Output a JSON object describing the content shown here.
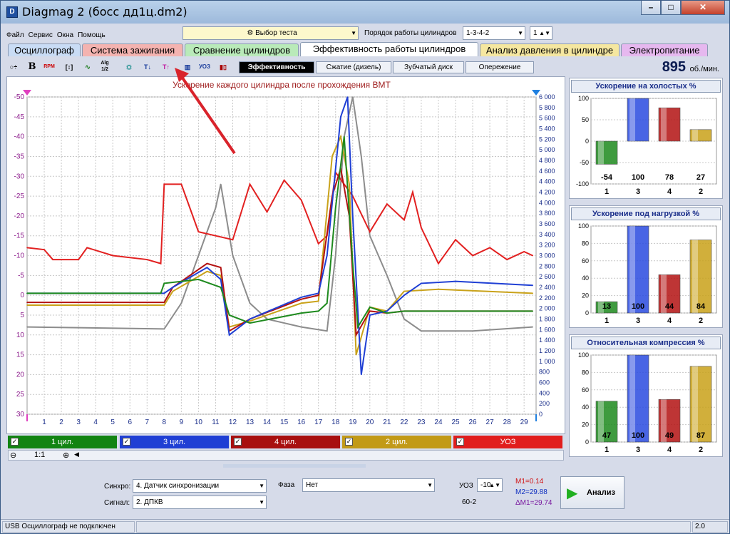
{
  "window": {
    "title": "Diagmag 2 (босс дд1ц.dm2)",
    "app_icon": "D"
  },
  "menu": [
    "Файл",
    "Сервис",
    "Окна",
    "Помощь"
  ],
  "test_select": {
    "value": "Выбор теста"
  },
  "cylinder_order": {
    "label": "Порядок работы цилиндров",
    "value": "1-3-4-2",
    "spin_value": "1"
  },
  "tabs": [
    {
      "label": "Осциллограф",
      "color": "#c9dcf5"
    },
    {
      "label": "Система зажигания",
      "color": "#f4b3b0"
    },
    {
      "label": "Сравнение цилиндров",
      "color": "#b9eab9"
    },
    {
      "label": "Эффективность работы цилиндров",
      "color": "#ffffff"
    },
    {
      "label": "Анализ давления в цилиндре",
      "color": "#f5e7a0"
    },
    {
      "label": "Электропитание",
      "color": "#e6b8ef"
    }
  ],
  "toolbar_icons": [
    "cursor-icon",
    "bold-icon",
    "rpm-icon",
    "measure-icon",
    "curve-icon",
    "algorithm-icon",
    "sensor-icon",
    "tdc-icon",
    "marker-icon",
    "cylinders-icon",
    "uoz-icon",
    "bar-icon"
  ],
  "toolbar_icon_text": {
    "rpm": "RPM",
    "alg": "Alg 1/2",
    "uoz": "УОЗ"
  },
  "subtabs": [
    "Эффективность",
    "Сжатие (дизель)",
    "Зубчатый диск",
    "Опережение"
  ],
  "rpm": {
    "value": "895",
    "unit": "об./мин."
  },
  "chart_data": {
    "type": "line",
    "title": "Ускорение каждого цилиндра после прохождения ВМТ",
    "x_ticks": [
      1,
      2,
      3,
      4,
      5,
      6,
      7,
      8,
      9,
      10,
      11,
      12,
      13,
      14,
      15,
      16,
      17,
      18,
      19,
      20,
      21,
      22,
      23,
      24,
      25,
      26,
      27,
      28,
      29
    ],
    "y_left_ticks": [
      -50,
      -45,
      -40,
      -35,
      -30,
      -25,
      -20,
      -15,
      -10,
      -5,
      0,
      5,
      10,
      15,
      20,
      25,
      30
    ],
    "y_left_range": [
      -50,
      30
    ],
    "y_right_ticks": [
      "6 000",
      "5 800",
      "5 600",
      "5 400",
      "5 200",
      "5 000",
      "4 800",
      "4 600",
      "4 400",
      "4 200",
      "4 000",
      "3 800",
      "3 600",
      "3 400",
      "3 200",
      "3 000",
      "2 800",
      "2 600",
      "2 400",
      "2 200",
      "2 000",
      "1 800",
      "1 600",
      "1 400",
      "1 200",
      "1 000",
      "800",
      "600",
      "400",
      "200",
      "0"
    ],
    "y_right_range": [
      0,
      6000
    ],
    "grid": true,
    "series": [
      {
        "name": "1 цил.",
        "color": "#1e8a1e",
        "points": [
          [
            0,
            -0.5
          ],
          [
            7.8,
            -0.5
          ],
          [
            8,
            -3
          ],
          [
            10,
            -4
          ],
          [
            11.3,
            -2
          ],
          [
            11.8,
            5
          ],
          [
            13,
            7
          ],
          [
            16,
            4.5
          ],
          [
            17,
            4
          ],
          [
            17.5,
            2
          ],
          [
            18,
            -22
          ],
          [
            18.5,
            -40
          ],
          [
            19,
            -8
          ],
          [
            19.3,
            8
          ],
          [
            20,
            3
          ],
          [
            21,
            4.5
          ],
          [
            22,
            4
          ],
          [
            29.5,
            4
          ]
        ]
      },
      {
        "name": "3 цил.",
        "color": "#1f3fd4",
        "points": [
          [
            0,
            -0.5
          ],
          [
            8,
            -0.5
          ],
          [
            8.5,
            -2
          ],
          [
            10.5,
            -7
          ],
          [
            11.3,
            -4
          ],
          [
            11.8,
            10
          ],
          [
            13,
            6
          ],
          [
            16,
            0.5
          ],
          [
            17,
            -0.5
          ],
          [
            17.5,
            -10
          ],
          [
            18.3,
            -45
          ],
          [
            18.7,
            -50
          ],
          [
            19,
            -20
          ],
          [
            19.5,
            20
          ],
          [
            20,
            5
          ],
          [
            21,
            4
          ],
          [
            22,
            0
          ],
          [
            23,
            -3
          ],
          [
            25,
            -3.5
          ],
          [
            29.5,
            -2.5
          ]
        ]
      },
      {
        "name": "4 цил.",
        "color": "#b31212",
        "points": [
          [
            0,
            1.8
          ],
          [
            8,
            1.8
          ],
          [
            8.5,
            -2
          ],
          [
            10.5,
            -8
          ],
          [
            11.3,
            -7
          ],
          [
            11.8,
            9
          ],
          [
            13,
            6
          ],
          [
            16,
            1
          ],
          [
            17,
            0
          ],
          [
            17.8,
            -25
          ],
          [
            18.3,
            -32
          ],
          [
            18.8,
            -20
          ],
          [
            19.2,
            10
          ],
          [
            20,
            4
          ],
          [
            21,
            4.5
          ],
          [
            22,
            4
          ],
          [
            29.5,
            4
          ]
        ]
      },
      {
        "name": "2 цил.",
        "color": "#c9a21a",
        "points": [
          [
            0,
            2.5
          ],
          [
            8,
            2.5
          ],
          [
            8.5,
            -1
          ],
          [
            10.5,
            -6
          ],
          [
            11.3,
            -5
          ],
          [
            11.8,
            8
          ],
          [
            13,
            6.5
          ],
          [
            16,
            2
          ],
          [
            17,
            1.5
          ],
          [
            17.8,
            -35
          ],
          [
            18.3,
            -40
          ],
          [
            18.8,
            -28
          ],
          [
            19.2,
            15
          ],
          [
            20,
            3
          ],
          [
            21,
            4
          ],
          [
            22,
            -1
          ],
          [
            24,
            -1.5
          ],
          [
            29.5,
            -0.5
          ]
        ]
      },
      {
        "name": "УОЗ",
        "color": "#e22020",
        "points": [
          [
            0,
            -12
          ],
          [
            1,
            -11.5
          ],
          [
            1.5,
            -9
          ],
          [
            3,
            -9
          ],
          [
            3.5,
            -12
          ],
          [
            5,
            -10
          ],
          [
            7,
            -9
          ],
          [
            7.8,
            -8
          ],
          [
            8,
            -28
          ],
          [
            9,
            -28
          ],
          [
            9.5,
            -22
          ],
          [
            10,
            -16
          ],
          [
            11,
            -15
          ],
          [
            12,
            -14
          ],
          [
            13,
            -28
          ],
          [
            14,
            -21
          ],
          [
            14.5,
            -25
          ],
          [
            15,
            -29
          ],
          [
            16,
            -24
          ],
          [
            17,
            -13
          ],
          [
            17.5,
            -15
          ],
          [
            18,
            -31
          ],
          [
            19,
            -25
          ],
          [
            20,
            -16
          ],
          [
            21,
            -23
          ],
          [
            22,
            -19
          ],
          [
            22.5,
            -26
          ],
          [
            23,
            -17
          ],
          [
            24,
            -8
          ],
          [
            25,
            -14
          ],
          [
            26,
            -10
          ],
          [
            27,
            -12
          ],
          [
            28,
            -9
          ],
          [
            29,
            -11
          ],
          [
            29.5,
            -10
          ]
        ]
      },
      {
        "name": "",
        "color": "#8c8c8c",
        "points": [
          [
            0,
            8
          ],
          [
            8,
            8.5
          ],
          [
            9,
            2
          ],
          [
            10,
            -10
          ],
          [
            11,
            -22
          ],
          [
            11.3,
            -28
          ],
          [
            12,
            -10
          ],
          [
            13,
            2
          ],
          [
            14,
            6
          ],
          [
            16,
            8
          ],
          [
            17.5,
            9
          ],
          [
            18,
            -10
          ],
          [
            18.5,
            -40
          ],
          [
            19,
            -50
          ],
          [
            19.5,
            -35
          ],
          [
            20,
            -15
          ],
          [
            21,
            -5
          ],
          [
            22,
            6
          ],
          [
            23,
            9
          ],
          [
            26,
            9
          ],
          [
            29.5,
            8
          ]
        ]
      }
    ]
  },
  "legend": [
    {
      "label": "1 цил.",
      "color": "#128412",
      "checked": "✓"
    },
    {
      "label": "3 цил.",
      "color": "#1f3fd4",
      "checked": "✓"
    },
    {
      "label": "4 цил.",
      "color": "#a80f0f",
      "checked": "✓"
    },
    {
      "label": "2 цил.",
      "color": "#c29a17",
      "checked": "✓"
    },
    {
      "label": "УОЗ",
      "color": "#e11d1d",
      "checked": "✓"
    }
  ],
  "zoom": {
    "minus": "⊖",
    "value": "1:1",
    "plus": "⊕"
  },
  "bar_panels": [
    {
      "title": "Ускорение на холостых %",
      "yticks": [
        "100",
        "50",
        "0",
        "-50",
        "-100"
      ],
      "yrange": [
        -100,
        100
      ],
      "bars": [
        {
          "cyl": "1",
          "value": -54,
          "label": "-54",
          "color": "#1e8a1e"
        },
        {
          "cyl": "3",
          "value": 100,
          "label": "100",
          "color": "#2a4be0"
        },
        {
          "cyl": "4",
          "value": 78,
          "label": "78",
          "color": "#b31212"
        },
        {
          "cyl": "2",
          "value": 27,
          "label": "27",
          "color": "#c9a21a"
        }
      ]
    },
    {
      "title": "Ускорение под нагрузкой %",
      "yticks": [
        "100",
        "80",
        "60",
        "40",
        "20",
        "0"
      ],
      "yrange": [
        0,
        100
      ],
      "bars": [
        {
          "cyl": "1",
          "value": 13,
          "label": "13",
          "color": "#1e8a1e"
        },
        {
          "cyl": "3",
          "value": 100,
          "label": "100",
          "color": "#2a4be0"
        },
        {
          "cyl": "4",
          "value": 44,
          "label": "44",
          "color": "#b31212"
        },
        {
          "cyl": "2",
          "value": 84,
          "label": "84",
          "color": "#c9a21a"
        }
      ]
    },
    {
      "title": "Относительная компрессия %",
      "yticks": [
        "100",
        "80",
        "60",
        "40",
        "20",
        "0"
      ],
      "yrange": [
        0,
        100
      ],
      "bars": [
        {
          "cyl": "1",
          "value": 47,
          "label": "47",
          "color": "#1e8a1e"
        },
        {
          "cyl": "3",
          "value": 100,
          "label": "100",
          "color": "#2a4be0"
        },
        {
          "cyl": "4",
          "value": 49,
          "label": "49",
          "color": "#b31212"
        },
        {
          "cyl": "2",
          "value": 87,
          "label": "87",
          "color": "#c9a21a"
        }
      ]
    }
  ],
  "bottom": {
    "sync_label": "Синхро:",
    "sync_value": "4.  Датчик синхронизации",
    "signal_label": "Сигнал:",
    "signal_value": "2.  ДПКВ",
    "phase_label": "Фаза",
    "phase_value": "Нет",
    "uoz_label": "УОЗ",
    "uoz_value": "-10",
    "wheel": "60-2",
    "m1": "M1=0.14",
    "m2": "M2=29.88",
    "dm": "ΔM1=29.74",
    "analyze": "Анализ"
  },
  "status": {
    "text": "USB Осциллограф не подключен",
    "version": "2.0"
  }
}
